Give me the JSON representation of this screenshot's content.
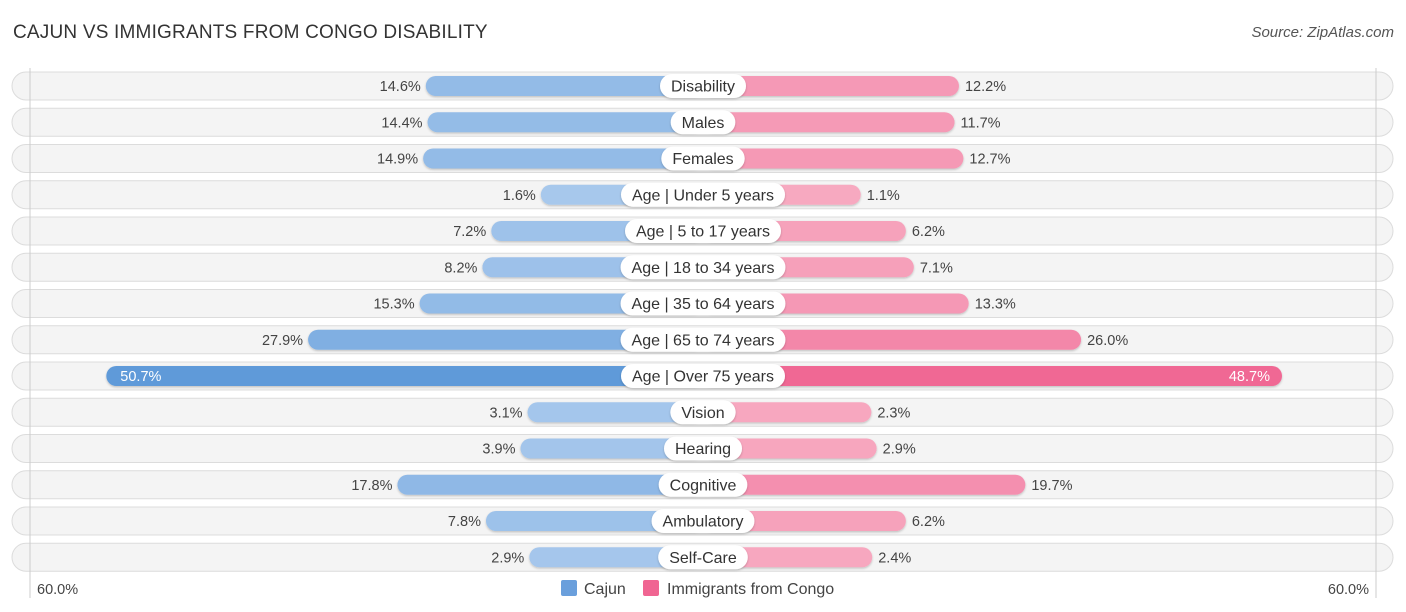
{
  "header": {
    "title": "CAJUN VS IMMIGRANTS FROM CONGO DISABILITY",
    "source": "Source: ZipAtlas.com"
  },
  "colors": {
    "cajun_light": "#a9c9ed",
    "cajun_dark": "#5e9ad9",
    "congo_light": "#f7aac1",
    "congo_dark": "#f06592"
  },
  "chart_data": {
    "type": "bar",
    "orientation": "horizontal-diverging",
    "title": "CAJUN VS IMMIGRANTS FROM CONGO DISABILITY",
    "categories": [
      "Disability",
      "Males",
      "Females",
      "Age | Under 5 years",
      "Age | 5 to 17 years",
      "Age | 18 to 34 years",
      "Age | 35 to 64 years",
      "Age | 65 to 74 years",
      "Age | Over 75 years",
      "Vision",
      "Hearing",
      "Cognitive",
      "Ambulatory",
      "Self-Care"
    ],
    "series": [
      {
        "name": "Cajun",
        "side": "left",
        "values": [
          14.6,
          14.4,
          14.9,
          1.6,
          7.2,
          8.2,
          15.3,
          27.9,
          50.7,
          3.1,
          3.9,
          17.8,
          7.8,
          2.9
        ],
        "labels": [
          "14.6%",
          "14.4%",
          "14.9%",
          "1.6%",
          "7.2%",
          "8.2%",
          "15.3%",
          "27.9%",
          "50.7%",
          "3.1%",
          "3.9%",
          "17.8%",
          "7.8%",
          "2.9%"
        ]
      },
      {
        "name": "Immigrants from Congo",
        "side": "right",
        "values": [
          12.2,
          11.7,
          12.7,
          1.1,
          6.2,
          7.1,
          13.3,
          26.0,
          48.7,
          2.3,
          2.9,
          19.7,
          6.2,
          2.4
        ],
        "labels": [
          "12.2%",
          "11.7%",
          "12.7%",
          "1.1%",
          "6.2%",
          "7.1%",
          "13.3%",
          "26.0%",
          "48.7%",
          "2.3%",
          "2.9%",
          "19.7%",
          "6.2%",
          "2.4%"
        ]
      }
    ],
    "highlighted_category": "Age | Over 75 years",
    "xlim": [
      0,
      60
    ],
    "axis_labels": {
      "left": "60.0%",
      "right": "60.0%"
    },
    "legend": {
      "placement": "bottom-center",
      "entries": [
        "Cajun",
        "Immigrants from Congo"
      ]
    },
    "unit": "%"
  }
}
